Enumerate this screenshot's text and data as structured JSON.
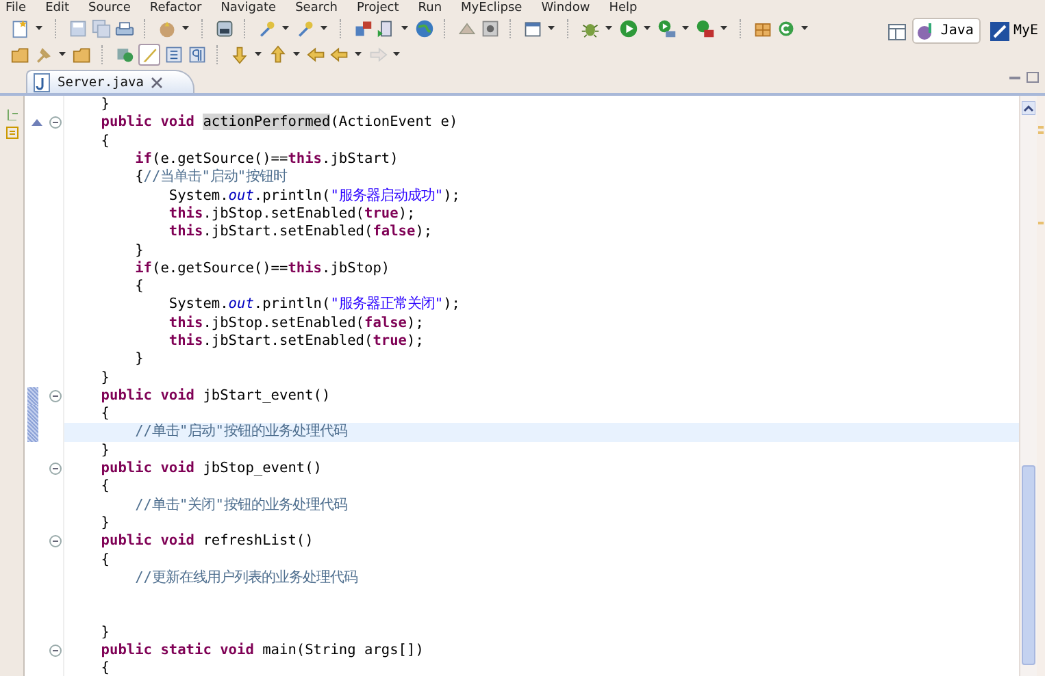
{
  "menu": [
    "File",
    "Edit",
    "Source",
    "Refactor",
    "Navigate",
    "Search",
    "Project",
    "Run",
    "MyEclipse",
    "Window",
    "Help"
  ],
  "perspectives": [
    {
      "label": "Java",
      "selected": true
    },
    {
      "label": "MyE",
      "selected": false
    }
  ],
  "tabs": [
    {
      "label": "Server.java",
      "selected": true
    }
  ],
  "editor": {
    "lines": [
      {
        "kind": "code",
        "tokens": [
          {
            "kind": "plain",
            "text": "    }"
          }
        ],
        "override": false,
        "fold": false,
        "changed": false,
        "highlighted": false
      },
      {
        "kind": "code",
        "tokens": [
          {
            "kind": "keyword",
            "text": "    public "
          },
          {
            "kind": "keyword",
            "text": "void "
          },
          {
            "kind": "occurrence",
            "text": "actionPerformed"
          },
          {
            "kind": "plain",
            "text": "(ActionEvent e)"
          }
        ],
        "override": true,
        "fold": true,
        "changed": false,
        "highlighted": false
      },
      {
        "kind": "code",
        "tokens": [
          {
            "kind": "plain",
            "text": "    {"
          }
        ],
        "override": false,
        "fold": false,
        "changed": false,
        "highlighted": false
      },
      {
        "kind": "code",
        "tokens": [
          {
            "kind": "keyword",
            "text": "        if"
          },
          {
            "kind": "plain",
            "text": "(e.getSource()=="
          },
          {
            "kind": "keyword",
            "text": "this"
          },
          {
            "kind": "plain",
            "text": ".jbStart)"
          }
        ],
        "override": false,
        "fold": false,
        "changed": false,
        "highlighted": false
      },
      {
        "kind": "code",
        "tokens": [
          {
            "kind": "plain",
            "text": "        {"
          },
          {
            "kind": "comment",
            "text": "//当单击\"启动\"按钮时"
          }
        ],
        "override": false,
        "fold": false,
        "changed": false,
        "highlighted": false
      },
      {
        "kind": "code",
        "tokens": [
          {
            "kind": "plain",
            "text": "            System."
          },
          {
            "kind": "field",
            "text": "out"
          },
          {
            "kind": "plain",
            "text": ".println("
          },
          {
            "kind": "string",
            "text": "\"服务器启动成功\""
          },
          {
            "kind": "plain",
            "text": ");"
          }
        ],
        "override": false,
        "fold": false,
        "changed": false,
        "highlighted": false
      },
      {
        "kind": "code",
        "tokens": [
          {
            "kind": "keyword",
            "text": "            this"
          },
          {
            "kind": "plain",
            "text": ".jbStop.setEnabled("
          },
          {
            "kind": "keyword",
            "text": "true"
          },
          {
            "kind": "plain",
            "text": ");"
          }
        ],
        "override": false,
        "fold": false,
        "changed": false,
        "highlighted": false
      },
      {
        "kind": "code",
        "tokens": [
          {
            "kind": "keyword",
            "text": "            this"
          },
          {
            "kind": "plain",
            "text": ".jbStart.setEnabled("
          },
          {
            "kind": "keyword",
            "text": "false"
          },
          {
            "kind": "plain",
            "text": ");"
          }
        ],
        "override": false,
        "fold": false,
        "changed": false,
        "highlighted": false
      },
      {
        "kind": "code",
        "tokens": [
          {
            "kind": "plain",
            "text": "        }"
          }
        ],
        "override": false,
        "fold": false,
        "changed": false,
        "highlighted": false
      },
      {
        "kind": "code",
        "tokens": [
          {
            "kind": "keyword",
            "text": "        if"
          },
          {
            "kind": "plain",
            "text": "(e.getSource()=="
          },
          {
            "kind": "keyword",
            "text": "this"
          },
          {
            "kind": "plain",
            "text": ".jbStop)"
          }
        ],
        "override": false,
        "fold": false,
        "changed": false,
        "highlighted": false
      },
      {
        "kind": "code",
        "tokens": [
          {
            "kind": "plain",
            "text": "        {"
          }
        ],
        "override": false,
        "fold": false,
        "changed": false,
        "highlighted": false
      },
      {
        "kind": "code",
        "tokens": [
          {
            "kind": "plain",
            "text": "            System."
          },
          {
            "kind": "field",
            "text": "out"
          },
          {
            "kind": "plain",
            "text": ".println("
          },
          {
            "kind": "string",
            "text": "\"服务器正常关闭\""
          },
          {
            "kind": "plain",
            "text": ");"
          }
        ],
        "override": false,
        "fold": false,
        "changed": false,
        "highlighted": false
      },
      {
        "kind": "code",
        "tokens": [
          {
            "kind": "keyword",
            "text": "            this"
          },
          {
            "kind": "plain",
            "text": ".jbStop.setEnabled("
          },
          {
            "kind": "keyword",
            "text": "false"
          },
          {
            "kind": "plain",
            "text": ");"
          }
        ],
        "override": false,
        "fold": false,
        "changed": false,
        "highlighted": false
      },
      {
        "kind": "code",
        "tokens": [
          {
            "kind": "keyword",
            "text": "            this"
          },
          {
            "kind": "plain",
            "text": ".jbStart.setEnabled("
          },
          {
            "kind": "keyword",
            "text": "true"
          },
          {
            "kind": "plain",
            "text": ");"
          }
        ],
        "override": false,
        "fold": false,
        "changed": false,
        "highlighted": false
      },
      {
        "kind": "code",
        "tokens": [
          {
            "kind": "plain",
            "text": "        }"
          }
        ],
        "override": false,
        "fold": false,
        "changed": false,
        "highlighted": false
      },
      {
        "kind": "code",
        "tokens": [
          {
            "kind": "plain",
            "text": "    }"
          }
        ],
        "override": false,
        "fold": false,
        "changed": false,
        "highlighted": false
      },
      {
        "kind": "code",
        "tokens": [
          {
            "kind": "keyword",
            "text": "    public "
          },
          {
            "kind": "keyword",
            "text": "void "
          },
          {
            "kind": "plain",
            "text": "jbStart_event()"
          }
        ],
        "override": false,
        "fold": true,
        "changed": true,
        "highlighted": false
      },
      {
        "kind": "code",
        "tokens": [
          {
            "kind": "plain",
            "text": "    {"
          }
        ],
        "override": false,
        "fold": false,
        "changed": true,
        "highlighted": false
      },
      {
        "kind": "code",
        "tokens": [
          {
            "kind": "comment",
            "text": "        //单击\"启动\"按钮的业务处理代码"
          }
        ],
        "override": false,
        "fold": false,
        "changed": true,
        "highlighted": true
      },
      {
        "kind": "code",
        "tokens": [
          {
            "kind": "plain",
            "text": "    }"
          }
        ],
        "override": false,
        "fold": false,
        "changed": false,
        "highlighted": false
      },
      {
        "kind": "code",
        "tokens": [
          {
            "kind": "keyword",
            "text": "    public "
          },
          {
            "kind": "keyword",
            "text": "void "
          },
          {
            "kind": "plain",
            "text": "jbStop_event()"
          }
        ],
        "override": false,
        "fold": true,
        "changed": false,
        "highlighted": false
      },
      {
        "kind": "code",
        "tokens": [
          {
            "kind": "plain",
            "text": "    {"
          }
        ],
        "override": false,
        "fold": false,
        "changed": false,
        "highlighted": false
      },
      {
        "kind": "code",
        "tokens": [
          {
            "kind": "comment",
            "text": "        //单击\"关闭\"按钮的业务处理代码"
          }
        ],
        "override": false,
        "fold": false,
        "changed": false,
        "highlighted": false
      },
      {
        "kind": "code",
        "tokens": [
          {
            "kind": "plain",
            "text": "    }"
          }
        ],
        "override": false,
        "fold": false,
        "changed": false,
        "highlighted": false
      },
      {
        "kind": "code",
        "tokens": [
          {
            "kind": "keyword",
            "text": "    public "
          },
          {
            "kind": "keyword",
            "text": "void "
          },
          {
            "kind": "plain",
            "text": "refreshList()"
          }
        ],
        "override": false,
        "fold": true,
        "changed": false,
        "highlighted": false
      },
      {
        "kind": "code",
        "tokens": [
          {
            "kind": "plain",
            "text": "    {"
          }
        ],
        "override": false,
        "fold": false,
        "changed": false,
        "highlighted": false
      },
      {
        "kind": "code",
        "tokens": [
          {
            "kind": "comment",
            "text": "        //更新在线用户列表的业务处理代码"
          }
        ],
        "override": false,
        "fold": false,
        "changed": false,
        "highlighted": false
      },
      {
        "kind": "blank"
      },
      {
        "kind": "blank"
      },
      {
        "kind": "code",
        "tokens": [
          {
            "kind": "plain",
            "text": "    }"
          }
        ],
        "override": false,
        "fold": false,
        "changed": false,
        "highlighted": false
      },
      {
        "kind": "code",
        "tokens": [
          {
            "kind": "keyword",
            "text": "    public "
          },
          {
            "kind": "keyword",
            "text": "static "
          },
          {
            "kind": "keyword",
            "text": "void "
          },
          {
            "kind": "plain",
            "text": "main(String args[])"
          }
        ],
        "override": false,
        "fold": true,
        "changed": false,
        "highlighted": false
      },
      {
        "kind": "code",
        "tokens": [
          {
            "kind": "plain",
            "text": "    {"
          }
        ],
        "override": false,
        "fold": false,
        "changed": false,
        "highlighted": false
      }
    ]
  }
}
